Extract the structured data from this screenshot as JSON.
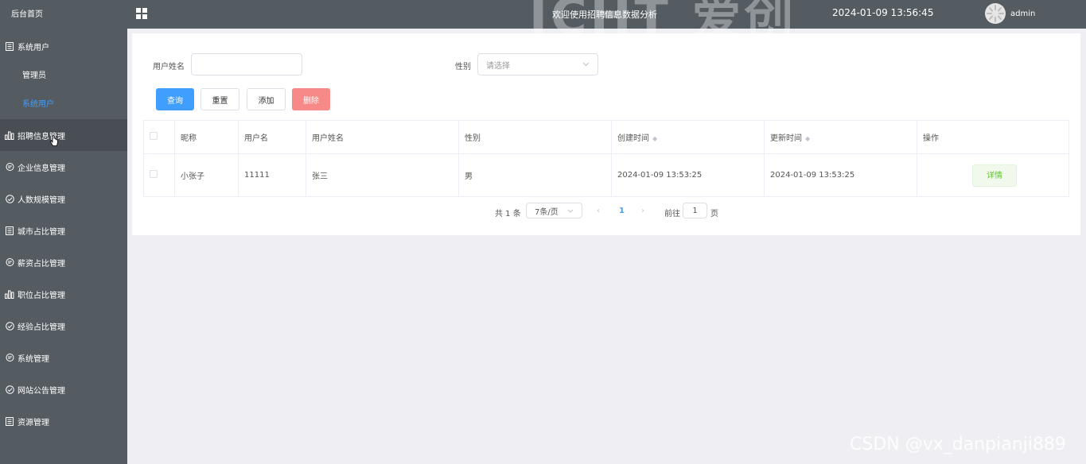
{
  "sidebar": {
    "home": "后台首页",
    "menu": [
      {
        "label": "系统用户",
        "icon": "document-icon"
      },
      {
        "label": "招聘信息管理",
        "icon": "bar-chart-icon"
      },
      {
        "label": "企业信息管理",
        "icon": "chat-icon"
      },
      {
        "label": "人数规模管理",
        "icon": "check-circle-icon"
      },
      {
        "label": "城市占比管理",
        "icon": "document-icon"
      },
      {
        "label": "薪资占比管理",
        "icon": "chat-icon"
      },
      {
        "label": "职位占比管理",
        "icon": "bar-chart-icon"
      },
      {
        "label": "经验占比管理",
        "icon": "check-circle-icon"
      },
      {
        "label": "系统管理",
        "icon": "chat-icon"
      },
      {
        "label": "网站公告管理",
        "icon": "check-circle-icon"
      },
      {
        "label": "资源管理",
        "icon": "document-icon"
      }
    ],
    "sub_items": [
      "管理员",
      "系统用户"
    ],
    "active_sub": "系统用户"
  },
  "header": {
    "title": "欢迎使用招聘信息数据分析",
    "time": "2024-01-09 13:56:45",
    "user": "admin",
    "watermark": "ICHT 爱创"
  },
  "search": {
    "name_label": "用户姓名",
    "name_value": "",
    "gender_label": "性别",
    "gender_placeholder": "请选择"
  },
  "toolbar": {
    "query": "查询",
    "reset": "重置",
    "add": "添加",
    "delete": "删除"
  },
  "table": {
    "columns": [
      "昵称",
      "用户名",
      "用户姓名",
      "性别",
      "创建时间",
      "更新时间",
      "操作"
    ],
    "rows": [
      {
        "nickname": "小张子",
        "username": "11111",
        "realname": "张三",
        "gender": "男",
        "created": "2024-01-09 13:53:25",
        "updated": "2024-01-09 13:53:25",
        "action": "详情"
      }
    ]
  },
  "pagination": {
    "total": "共 1 条",
    "page_size": "7条/页",
    "current": "1",
    "goto_label": "前往",
    "goto_value": "1",
    "page_suffix": "页"
  },
  "watermark_footer": "CSDN @vx_danpianji889",
  "colors": {
    "sidebar_bg": "#545b61",
    "primary": "#409eff",
    "danger": "#f78989",
    "success": "#67c23a"
  }
}
